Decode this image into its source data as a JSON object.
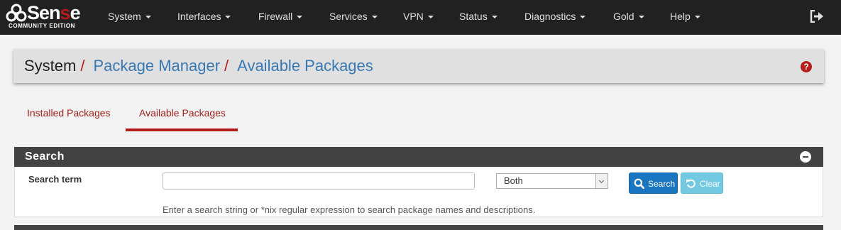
{
  "brand": {
    "name_part1": "Sen",
    "name_part2": "s",
    "name_part3": "e",
    "edition": "COMMUNITY EDITION",
    "icon": "pfsense-logo"
  },
  "nav": {
    "items": [
      {
        "label": "System"
      },
      {
        "label": "Interfaces"
      },
      {
        "label": "Firewall"
      },
      {
        "label": "Services"
      },
      {
        "label": "VPN"
      },
      {
        "label": "Status"
      },
      {
        "label": "Diagnostics"
      },
      {
        "label": "Gold"
      },
      {
        "label": "Help"
      }
    ],
    "logout_icon": "logout-icon"
  },
  "breadcrumb": {
    "items": [
      {
        "label": "System",
        "link": false
      },
      {
        "label": "Package Manager",
        "link": true
      },
      {
        "label": "Available Packages",
        "link": true
      }
    ],
    "separator": "/",
    "help_icon": "question-circle-icon",
    "help_glyph": "?"
  },
  "tabs": [
    {
      "label": "Installed Packages",
      "active": false
    },
    {
      "label": "Available Packages",
      "active": true
    }
  ],
  "search_panel": {
    "title": "Search",
    "collapse_icon": "minus-circle-icon",
    "term_label": "Search term",
    "term_value": "",
    "scope_selected": "Both",
    "search_button": "Search",
    "clear_button": "Clear",
    "help_text": "Enter a search string or *nix regular expression to search package names and descriptions."
  },
  "colors": {
    "navbar": "#212121",
    "accent_red": "#b71c1c",
    "link_blue": "#3778b7",
    "panel_head": "#424242",
    "search_btn": "#1a76c1",
    "clear_btn": "#5bc0de"
  }
}
